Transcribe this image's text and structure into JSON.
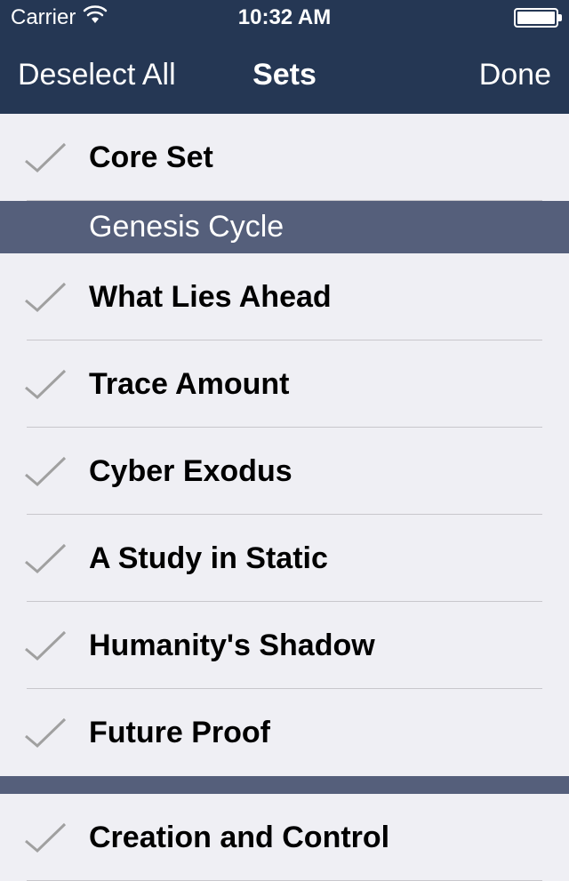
{
  "status": {
    "carrier": "Carrier",
    "time": "10:32 AM"
  },
  "nav": {
    "left": "Deselect All",
    "title": "Sets",
    "right": "Done"
  },
  "sections": [
    {
      "type": "item",
      "label": "Core Set"
    },
    {
      "type": "header",
      "label": "Genesis Cycle"
    },
    {
      "type": "item",
      "label": "What Lies Ahead"
    },
    {
      "type": "item",
      "label": "Trace Amount"
    },
    {
      "type": "item",
      "label": "Cyber Exodus"
    },
    {
      "type": "item",
      "label": "A Study in Static"
    },
    {
      "type": "item",
      "label": "Humanity's Shadow"
    },
    {
      "type": "item",
      "label": "Future Proof"
    },
    {
      "type": "header",
      "label": ""
    },
    {
      "type": "item",
      "label": "Creation and Control"
    }
  ],
  "colors": {
    "navBg": "#253754",
    "headerBg": "#555f7b",
    "listBg": "#efeff4",
    "checkStroke": "#a0a0a0"
  }
}
